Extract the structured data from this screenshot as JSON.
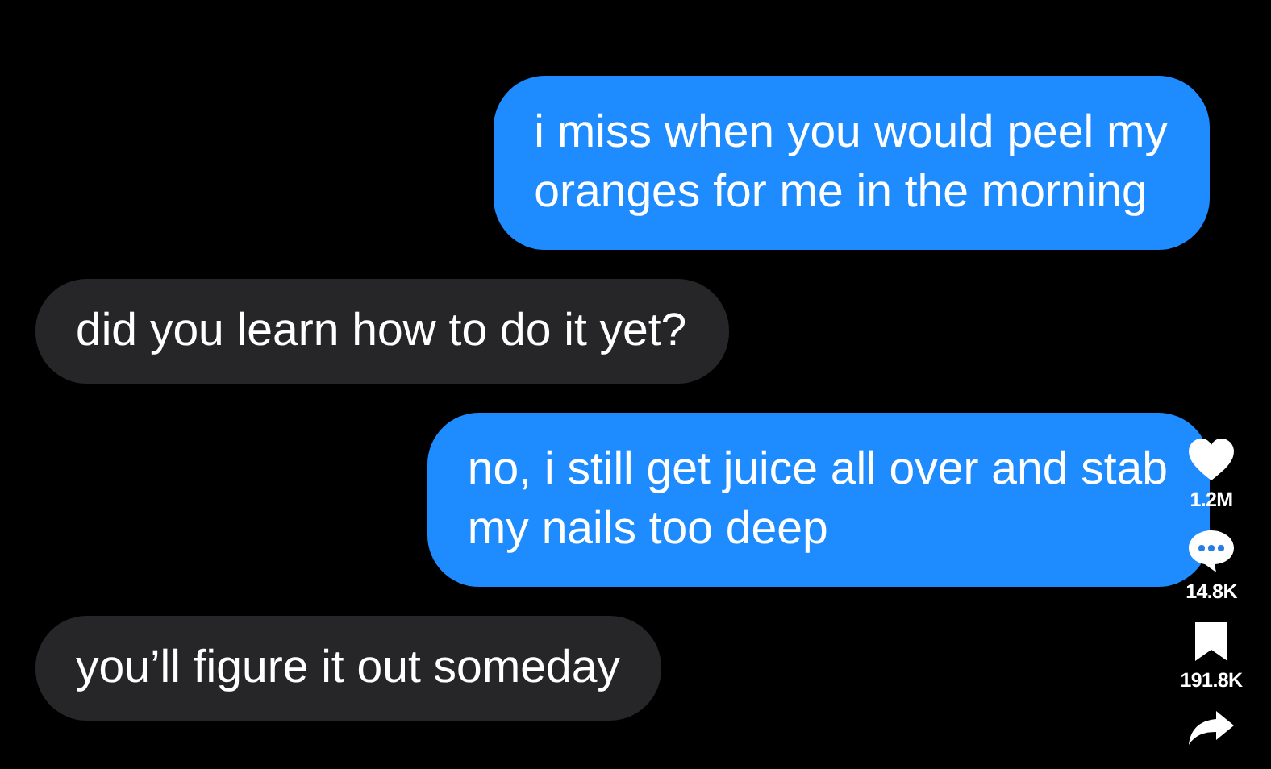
{
  "messages": [
    {
      "kind": "sent",
      "text": "i miss when you would peel my\noranges for me in the morning"
    },
    {
      "kind": "received",
      "text": "did you learn how to do it yet?"
    },
    {
      "kind": "sent",
      "text": "no, i still get juice all over and stab\nmy nails too deep"
    },
    {
      "kind": "received",
      "text": "you’ll figure it out someday"
    }
  ],
  "actions": [
    {
      "kind": "like",
      "count": "1.2M"
    },
    {
      "kind": "comment",
      "count": "14.8K"
    },
    {
      "kind": "save",
      "count": "191.8K"
    },
    {
      "kind": "share"
    }
  ]
}
